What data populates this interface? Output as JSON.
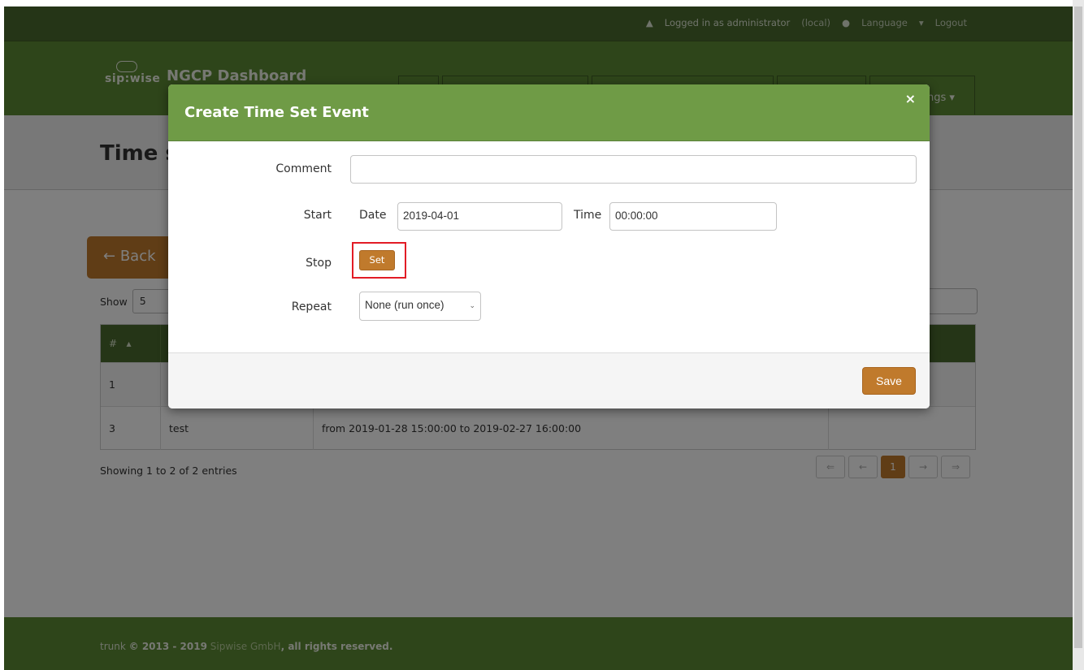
{
  "topbar": {
    "logged_in": "Logged in as administrator",
    "realm": "(local)",
    "language": "Language",
    "logout": "Logout"
  },
  "navbar": {
    "brand": "sip:wise",
    "app_title": "NGCP Dashboard",
    "last_tab_fragment": "ngs"
  },
  "page": {
    "title_fragment": "Time s",
    "back_label": "Back",
    "show_label": "Show",
    "show_value": "5",
    "table": {
      "header_first": "#",
      "rows": [
        {
          "id": "1",
          "name": "",
          "event": ""
        },
        {
          "id": "3",
          "name": "test",
          "event": "from 2019-01-28 15:00:00 to 2019-02-27 16:00:00"
        }
      ]
    },
    "showing": "Showing 1 to 2 of 2 entries",
    "pager": [
      "⇐",
      "←",
      "1",
      "→",
      "⇒"
    ]
  },
  "footer": {
    "build": "trunk",
    "copyright": "© 2013 - 2019",
    "company": "Sipwise GmbH",
    "rights": ", all rights reserved."
  },
  "modal": {
    "title": "Create Time Set Event",
    "close_glyph": "×",
    "comment_label": "Comment",
    "comment_value": "",
    "start_label": "Start",
    "date_label": "Date",
    "date_value": "2019-04-01",
    "time_label": "Time",
    "time_value": "00:00:00",
    "stop_label": "Stop",
    "set_label": "Set",
    "repeat_label": "Repeat",
    "repeat_value": "None (run once)",
    "save_label": "Save"
  },
  "colors": {
    "accent_green": "#5d8a35",
    "header_green": "#6f9b46",
    "button_orange": "#c07a2c",
    "highlight_red": "#e21c25"
  }
}
